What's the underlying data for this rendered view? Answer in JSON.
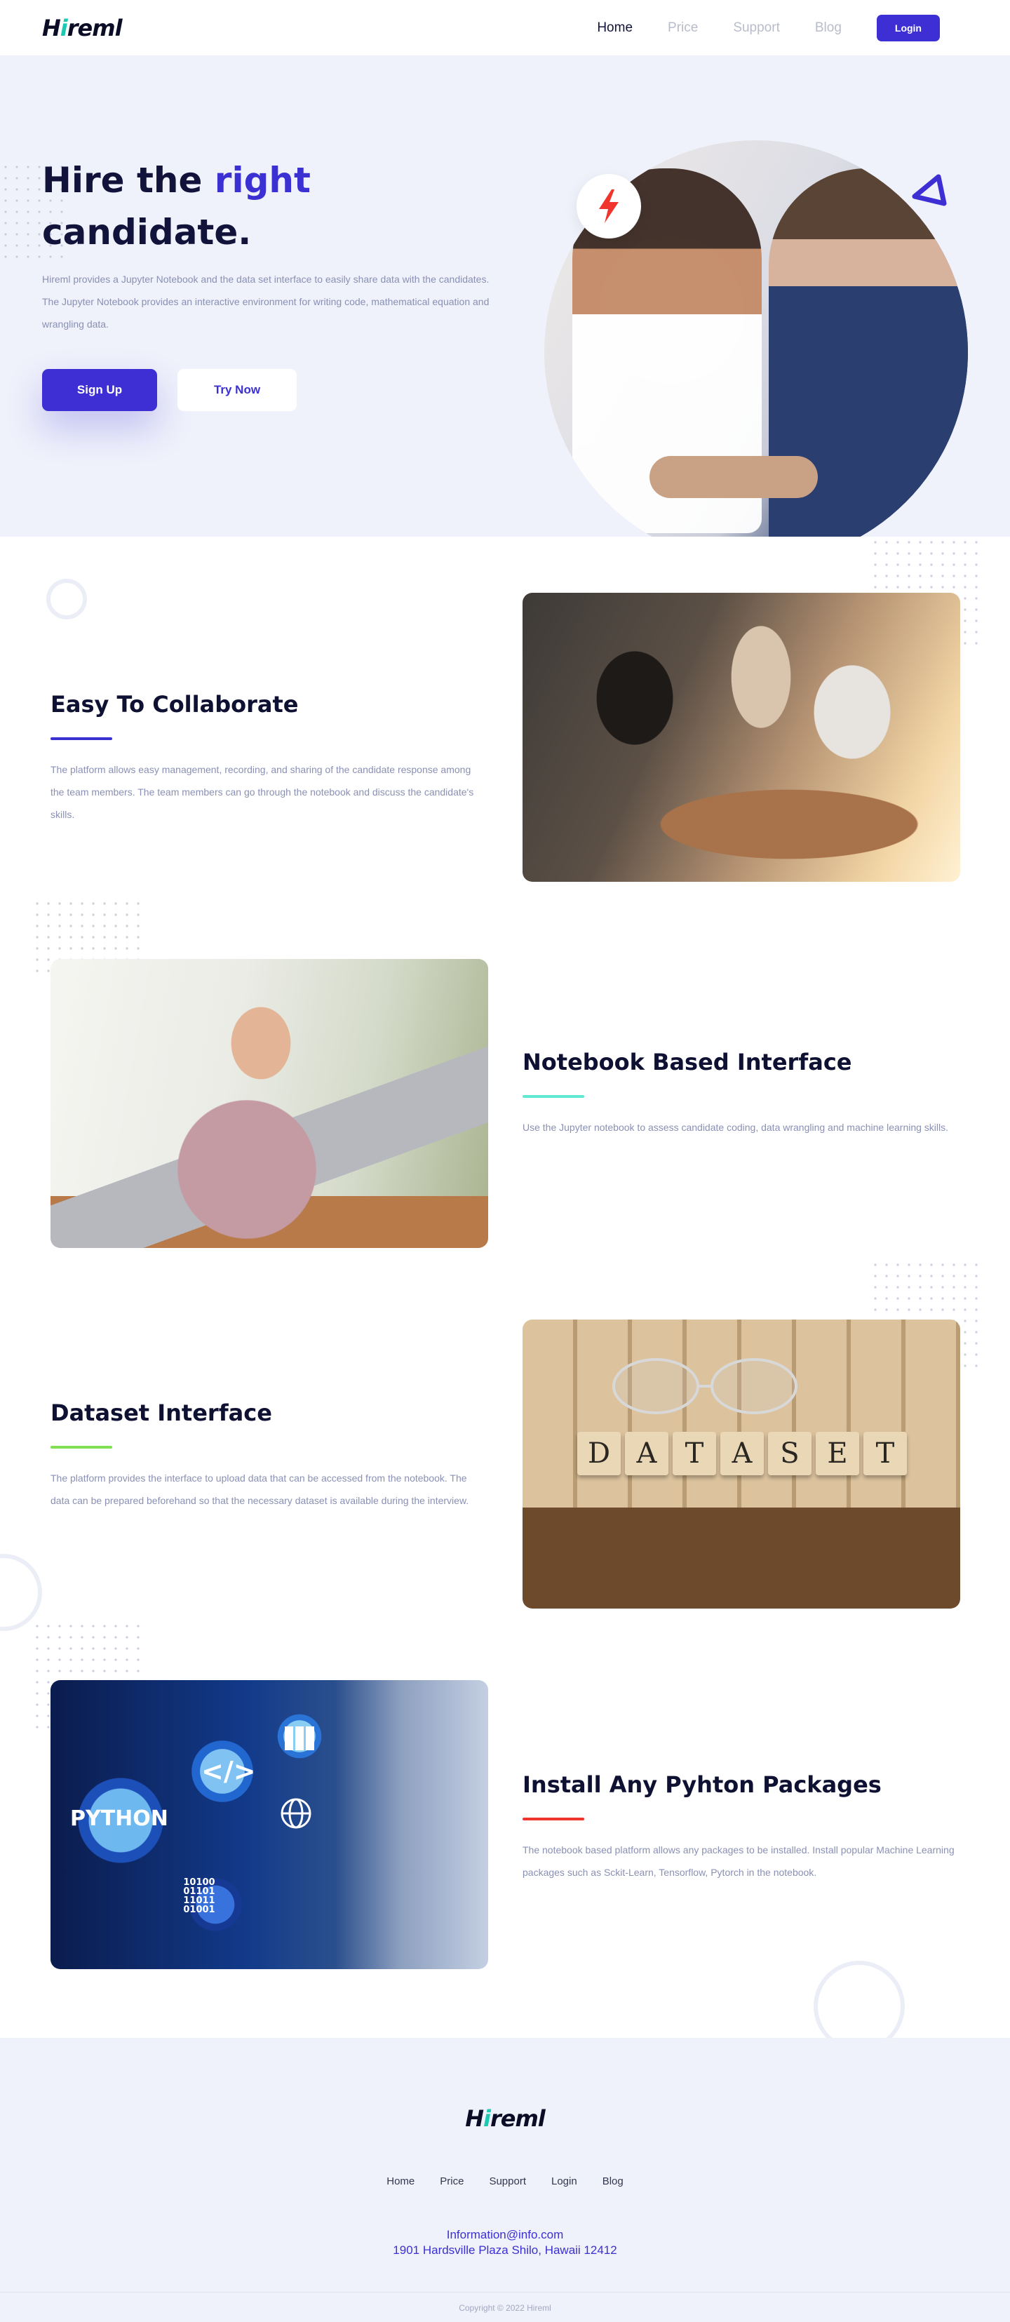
{
  "brand": {
    "logo": "Hireml",
    "logo_accent_letter": "i"
  },
  "nav": {
    "items": [
      {
        "label": "Home",
        "active": true
      },
      {
        "label": "Price",
        "active": false
      },
      {
        "label": "Support",
        "active": false
      },
      {
        "label": "Blog",
        "active": false
      }
    ],
    "login_label": "Login"
  },
  "hero": {
    "title_part1": "Hire the",
    "title_highlight": "right",
    "title_part2": "candidate.",
    "description": "Hireml provides a Jupyter Notebook and the data set interface to easily share data with the candidates. The Jupyter Notebook provides an interactive environment for writing code, mathematical equation and wrangling data.",
    "primary_button": "Sign Up",
    "secondary_button": "Try Now"
  },
  "features": [
    {
      "title": "Easy To Collaborate",
      "description": "The platform allows easy management, recording, and sharing of the candidate response among the team members. The team members can go through the notebook and discuss the candidate's skills.",
      "accent": "#3b30d1"
    },
    {
      "title": "Notebook Based Interface",
      "description": "Use the Jupyter notebook to assess candidate coding, data wrangling and machine learning skills.",
      "accent": "#5fe8d2"
    },
    {
      "title": "Dataset Interface",
      "description": "The platform provides the interface to upload data that can be accessed from the notebook. The data can be prepared beforehand so that the necessary dataset is available during the interview.",
      "accent": "#7ee052"
    },
    {
      "title": "Install Any Pyhton Packages",
      "description": "The notebook based platform allows any packages to be installed. Install popular Machine Learning packages such as Sckit-Learn, Tensorflow, Pytorch in the notebook.",
      "accent": "#f0342e"
    }
  ],
  "image_text": {
    "dataset_letters": [
      "D",
      "A",
      "T",
      "A",
      "S",
      "E",
      "T"
    ],
    "python_label": "PYTHON",
    "code_symbol": "</>",
    "binary": [
      "10100",
      "01101",
      "11011",
      "01001"
    ]
  },
  "footer": {
    "logo": "Hireml",
    "links": [
      "Home",
      "Price",
      "Support",
      "Login",
      "Blog"
    ],
    "email": "Information@info.com",
    "address": "1901 Hardsville Plaza Shilo, Hawaii 12412",
    "copyright": "Copyright © 2022 Hireml"
  },
  "icons": {
    "hero_badge": "lightning-bolt-icon",
    "hero_triangle": "triangle-outline-icon"
  },
  "colors": {
    "primary": "#3d2fd4",
    "bolt": "#f0342e",
    "hero_bg": "#eff1fb"
  }
}
